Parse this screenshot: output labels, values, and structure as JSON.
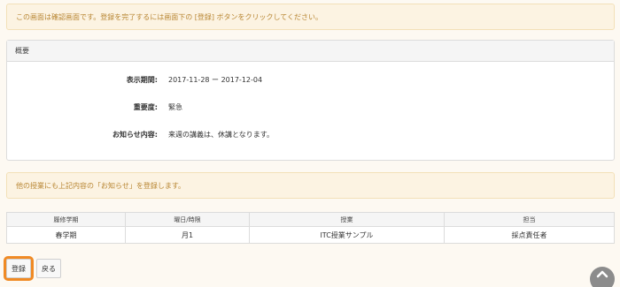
{
  "notice_top": "この画面は確認画面です。登録を完了するには画面下の [登録] ボタンをクリックしてください。",
  "panel": {
    "heading": "概要",
    "fields": [
      {
        "label": "表示期間:",
        "value": "2017-11-28 ー 2017-12-04"
      },
      {
        "label": "重要度:",
        "value": "緊急"
      },
      {
        "label": "お知らせ内容:",
        "value": "来週の講義は、休講となります。"
      }
    ]
  },
  "notice_mid": "他の授業にも上記内容の「お知らせ」を登録します。",
  "table": {
    "headers": [
      "履修学期",
      "曜日/時限",
      "授業",
      "担当"
    ],
    "rows": [
      [
        "春学期",
        "月1",
        "ITC授業サンプル",
        "採点責任者"
      ]
    ]
  },
  "buttons": {
    "register": "登録",
    "back": "戻る"
  },
  "icons": {
    "scroll_top": "chevron-up-circle-icon"
  }
}
